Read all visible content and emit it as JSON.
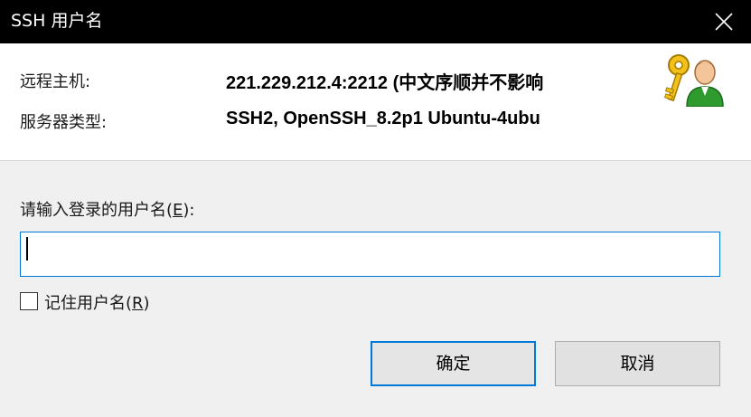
{
  "window": {
    "title": "SSH 用户名",
    "close_icon": "close-icon"
  },
  "info": {
    "host_label": "远程主机:",
    "host_value": "221.229.212.4:2212 (中文序顺并不影响",
    "server_type_label": "服务器类型:",
    "server_type_value": "SSH2, OpenSSH_8.2p1 Ubuntu-4ubu",
    "avatar_icon": "user-key-icon"
  },
  "form": {
    "prompt_label_prefix": "请输入登录的用户名(",
    "prompt_label_hotkey": "E",
    "prompt_label_suffix": "):",
    "username_value": "",
    "remember_label_prefix": "记住用户名(",
    "remember_label_hotkey": "R",
    "remember_label_suffix": ")",
    "remember_checked": false
  },
  "buttons": {
    "ok_label": "确定",
    "cancel_label": "取消"
  },
  "colors": {
    "titlebar": "#000000",
    "accent": "#0078d7",
    "panel": "#ffffff",
    "dialog_bg": "#f0f0f0"
  }
}
